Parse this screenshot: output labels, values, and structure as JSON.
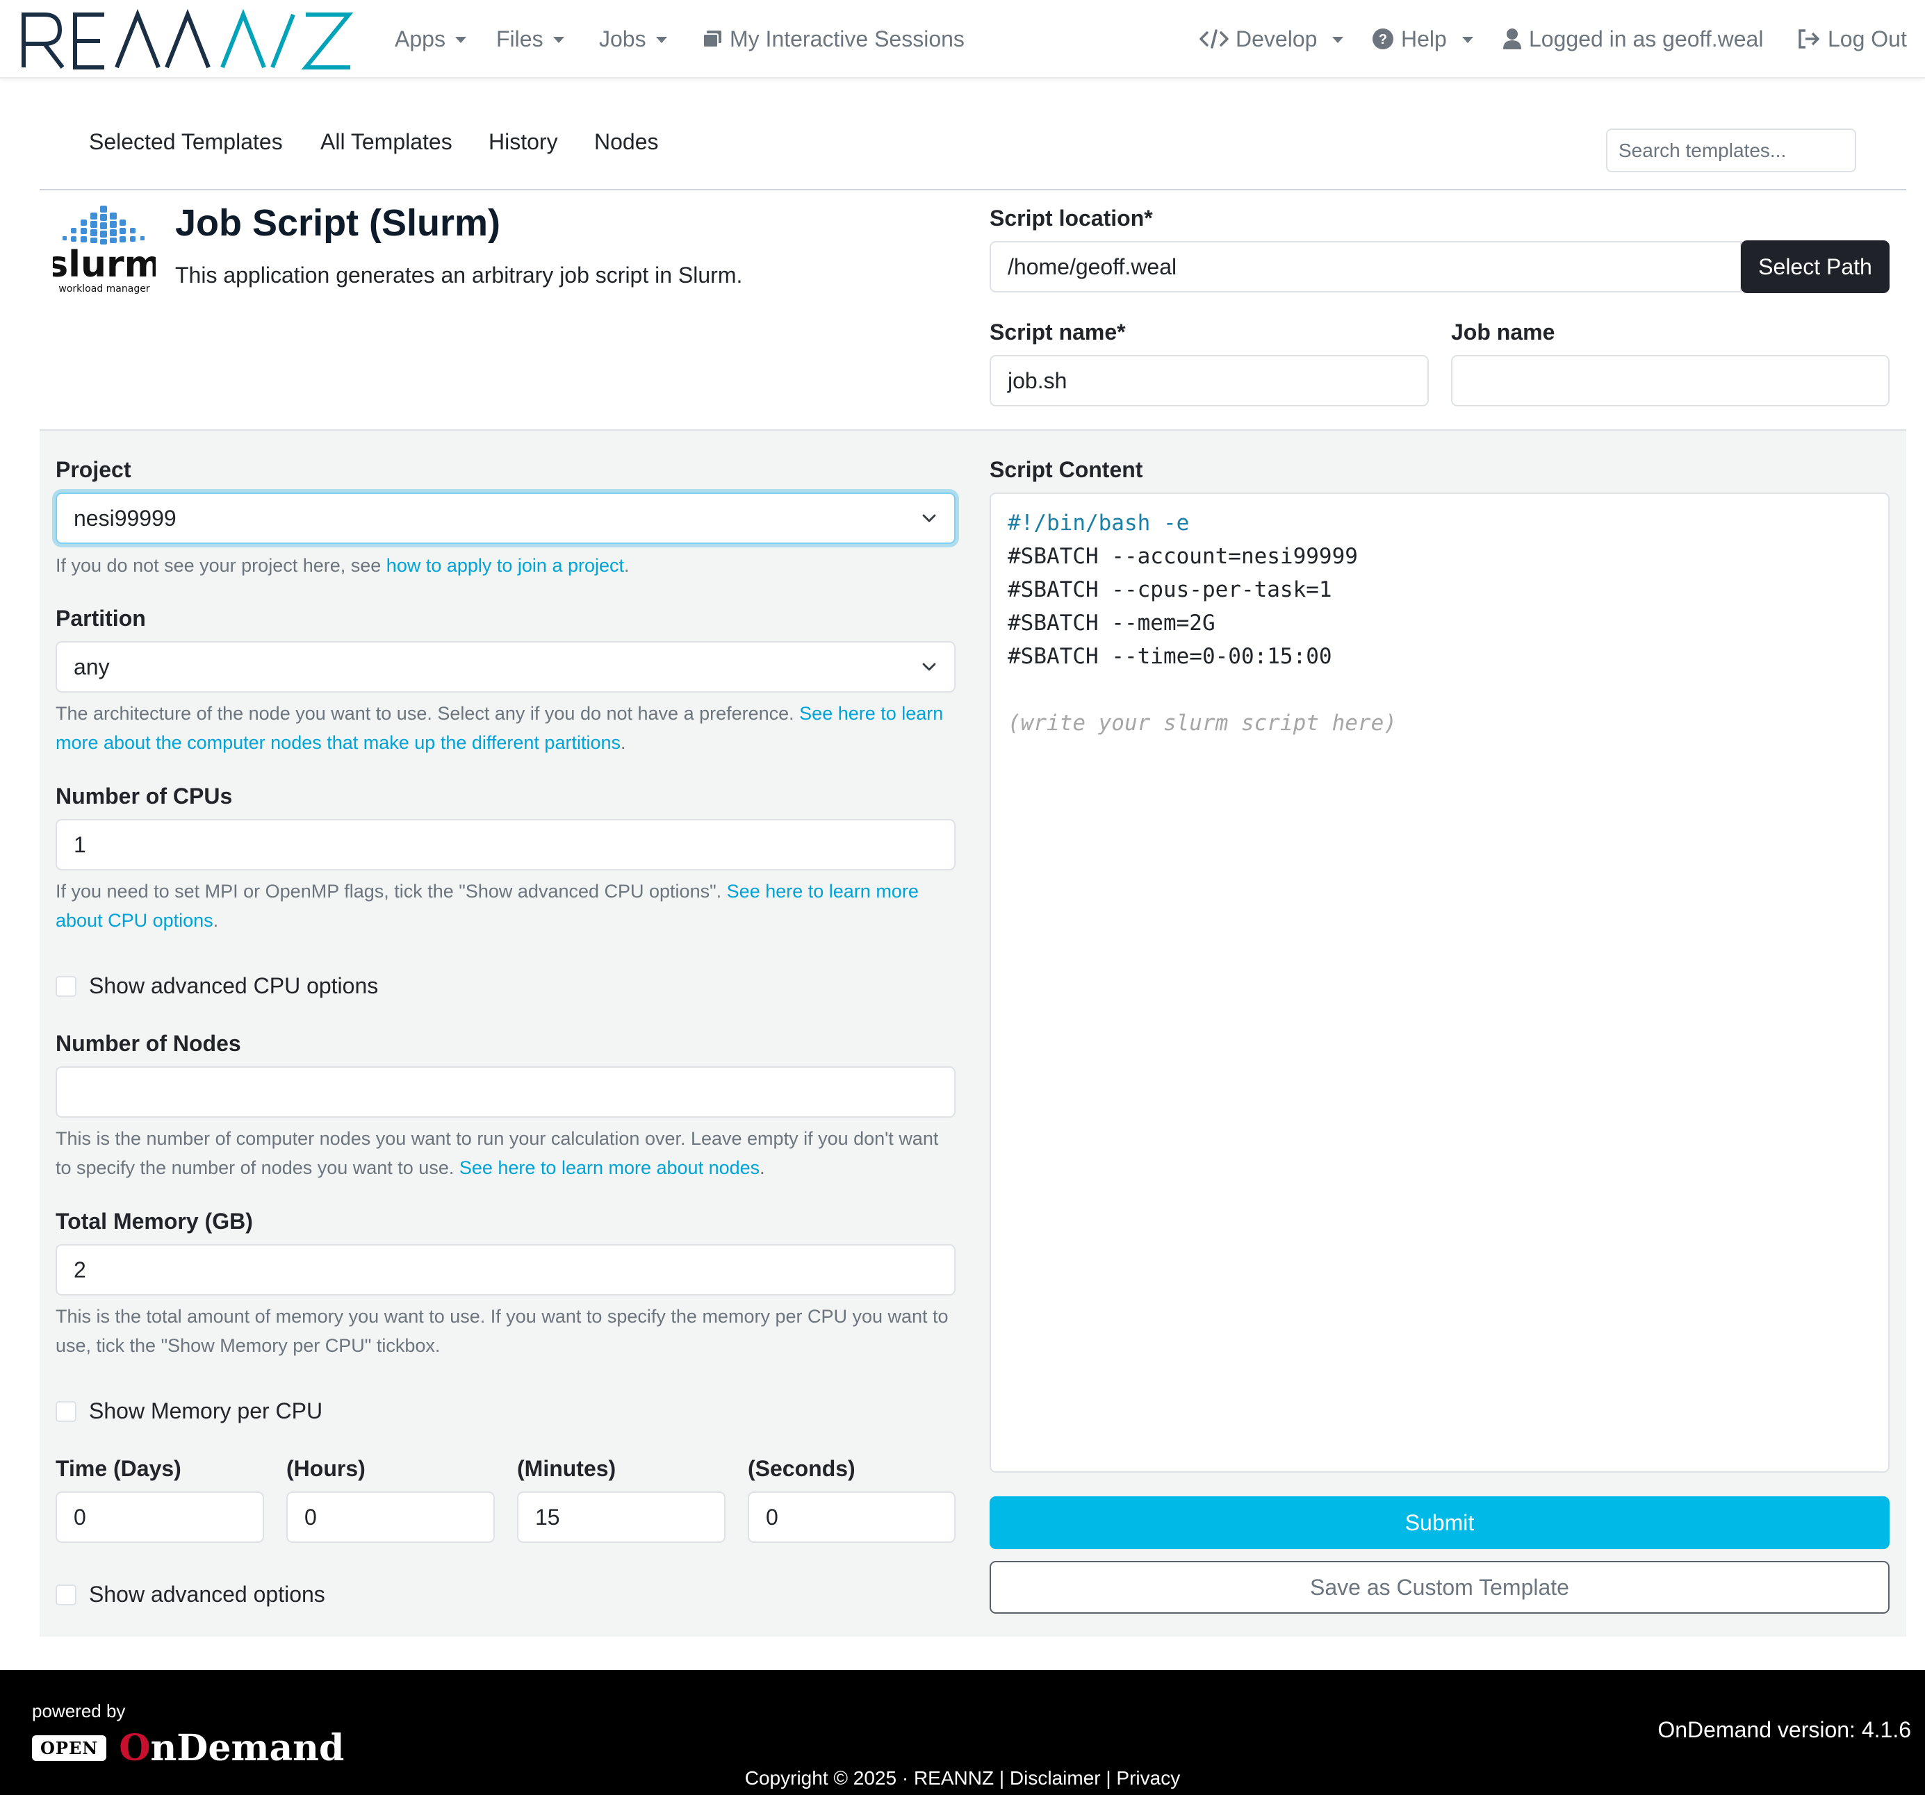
{
  "brand": {
    "name": "REANNZ"
  },
  "navbar": {
    "apps": "Apps",
    "files": "Files",
    "jobs": "Jobs",
    "sessions": "My Interactive Sessions",
    "develop": "Develop",
    "help": "Help",
    "user": "Logged in as geoff.weal",
    "logout": "Log Out"
  },
  "tabs": [
    {
      "label": "Selected Templates"
    },
    {
      "label": "All Templates"
    },
    {
      "label": "History"
    },
    {
      "label": "Nodes"
    }
  ],
  "search": {
    "placeholder": "Search templates..."
  },
  "app": {
    "logo_text": "slurm",
    "logo_subtext": "workload manager",
    "title": "Job Script (Slurm)",
    "description": "This application generates an arbitrary job script in Slurm."
  },
  "script_location": {
    "label": "Script location*",
    "value": "/home/geoff.weal",
    "button": "Select Path"
  },
  "script_name": {
    "label": "Script name*",
    "value": "job.sh"
  },
  "job_name": {
    "label": "Job name",
    "value": ""
  },
  "project": {
    "label": "Project",
    "value": "nesi99999",
    "help_text": "If you do not see your project here, see ",
    "help_link": "how to apply to join a project",
    "help_end": "."
  },
  "partition": {
    "label": "Partition",
    "value": "any",
    "help_text": "The architecture of the node you want to use. Select any if you do not have a preference. ",
    "help_link": "See here to learn more about the computer nodes that make up the different partitions",
    "help_end": "."
  },
  "cpus": {
    "label": "Number of CPUs",
    "value": "1",
    "help_text": "If you need to set MPI or OpenMP flags, tick the \"Show advanced CPU options\". ",
    "help_link": "See here to learn more about CPU options",
    "help_end": "."
  },
  "adv_cpu": {
    "label": "Show advanced CPU options",
    "checked": false
  },
  "nodes": {
    "label": "Number of Nodes",
    "value": "",
    "help_text": "This is the number of computer nodes you want to run your calculation over. Leave empty if you don't want to specify the number of nodes you want to use. ",
    "help_link": "See here to learn more about nodes",
    "help_end": "."
  },
  "memory": {
    "label": "Total Memory (GB)",
    "value": "2",
    "help_text": "This is the total amount of memory you want to use. If you want to specify the memory per CPU you want to use, tick the \"Show Memory per CPU\" tickbox."
  },
  "mem_per_cpu": {
    "label": "Show Memory per CPU",
    "checked": false
  },
  "time": {
    "days_label": "Time (Days)",
    "days": "0",
    "hours_label": "(Hours)",
    "hours": "0",
    "minutes_label": "(Minutes)",
    "minutes": "15",
    "seconds_label": "(Seconds)",
    "seconds": "0"
  },
  "adv_options": {
    "label": "Show advanced options",
    "checked": false
  },
  "script_content": {
    "label": "Script Content",
    "lines": [
      "#!/bin/bash -e",
      "#SBATCH --account=nesi99999",
      "#SBATCH --cpus-per-task=1",
      "#SBATCH --mem=2G",
      "#SBATCH --time=0-00:15:00"
    ],
    "placeholder": "(write your slurm script here)"
  },
  "actions": {
    "submit": "Submit",
    "save_template": "Save as Custom Template"
  },
  "footer": {
    "powered_by": "powered by",
    "open_badge": "OPEN",
    "ondemand_o": "O",
    "ondemand_rest": "nDemand",
    "version": "OnDemand version: 4.1.6",
    "copyright": "Copyright © 2025 · REANNZ | Disclaimer | Privacy"
  },
  "colors": {
    "brand_primary": "#1a2e44",
    "brand_accent": "#00a3b8",
    "submit": "#00b9e6",
    "link": "#00a3d6",
    "footer_bg": "#000000",
    "ondemand_red": "#c8102e"
  }
}
